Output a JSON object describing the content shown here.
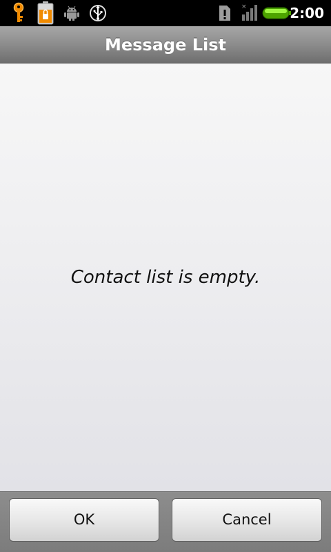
{
  "status_bar": {
    "time": "2:00",
    "icons": [
      "key-icon",
      "battery-lock-icon",
      "android-debug-icon",
      "usb-icon",
      "sd-card-warning-icon",
      "signal-icon",
      "battery-icon"
    ]
  },
  "header": {
    "title": "Message List"
  },
  "main": {
    "empty_message": "Contact list is empty."
  },
  "buttons": {
    "ok_label": "OK",
    "cancel_label": "Cancel"
  },
  "colors": {
    "status_bar_bg": "#000000",
    "battery_green": "#6fd400",
    "title_bar": "#8f8f8f",
    "button_bar": "#858585"
  }
}
